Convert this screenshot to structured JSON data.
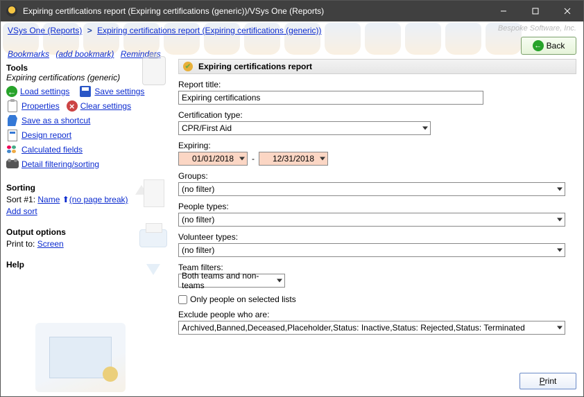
{
  "window": {
    "title": "Expiring certifications report (Expiring certifications (generic))/VSys One (Reports)"
  },
  "breadcrumbs": {
    "root": "VSys One (Reports)",
    "sep": ">",
    "current": "Expiring certifications report (Expiring certifications (generic))"
  },
  "company_tag": "Bespoke Software, Inc.",
  "linkbar": {
    "bookmarks": "Bookmarks",
    "add_bookmark": "(add bookmark)",
    "reminders": "Reminders"
  },
  "back_label": "Back",
  "sidebar": {
    "tools_heading": "Tools",
    "subtitle": "Expiring certifications (generic)",
    "load_settings": "Load settings",
    "save_settings": "Save settings",
    "properties": "Properties",
    "clear_settings": "Clear settings",
    "save_shortcut": "Save as a shortcut",
    "design_report": "Design report",
    "calculated_fields": "Calculated fields",
    "detail_filtering": "Detail filtering/sorting",
    "sorting_heading": "Sorting",
    "sort_prefix": "Sort #1:",
    "sort_field": "Name",
    "sort_breaks": "(no page break)",
    "add_sort": "Add sort",
    "output_heading": "Output options",
    "print_to_label": "Print to:",
    "print_to_value": "Screen",
    "help_heading": "Help"
  },
  "form": {
    "header": "Expiring certifications report",
    "report_title_label": "Report title:",
    "report_title_value": "Expiring certifications",
    "cert_type_label": "Certification type:",
    "cert_type_value": "CPR/First Aid",
    "expiring_label": "Expiring:",
    "date_from": "01/01/2018",
    "date_to": "12/31/2018",
    "date_dash": "-",
    "groups_label": "Groups:",
    "groups_value": "(no filter)",
    "people_types_label": "People types:",
    "people_types_value": "(no filter)",
    "volunteer_types_label": "Volunteer types:",
    "volunteer_types_value": "(no filter)",
    "team_filters_label": "Team filters:",
    "team_filters_value": "Both teams and non-teams",
    "only_selected_label": "Only people on selected lists",
    "exclude_label": "Exclude people who are:",
    "exclude_value": "Archived,Banned,Deceased,Placeholder,Status: Inactive,Status: Rejected,Status: Terminated"
  },
  "print_label": "Print"
}
